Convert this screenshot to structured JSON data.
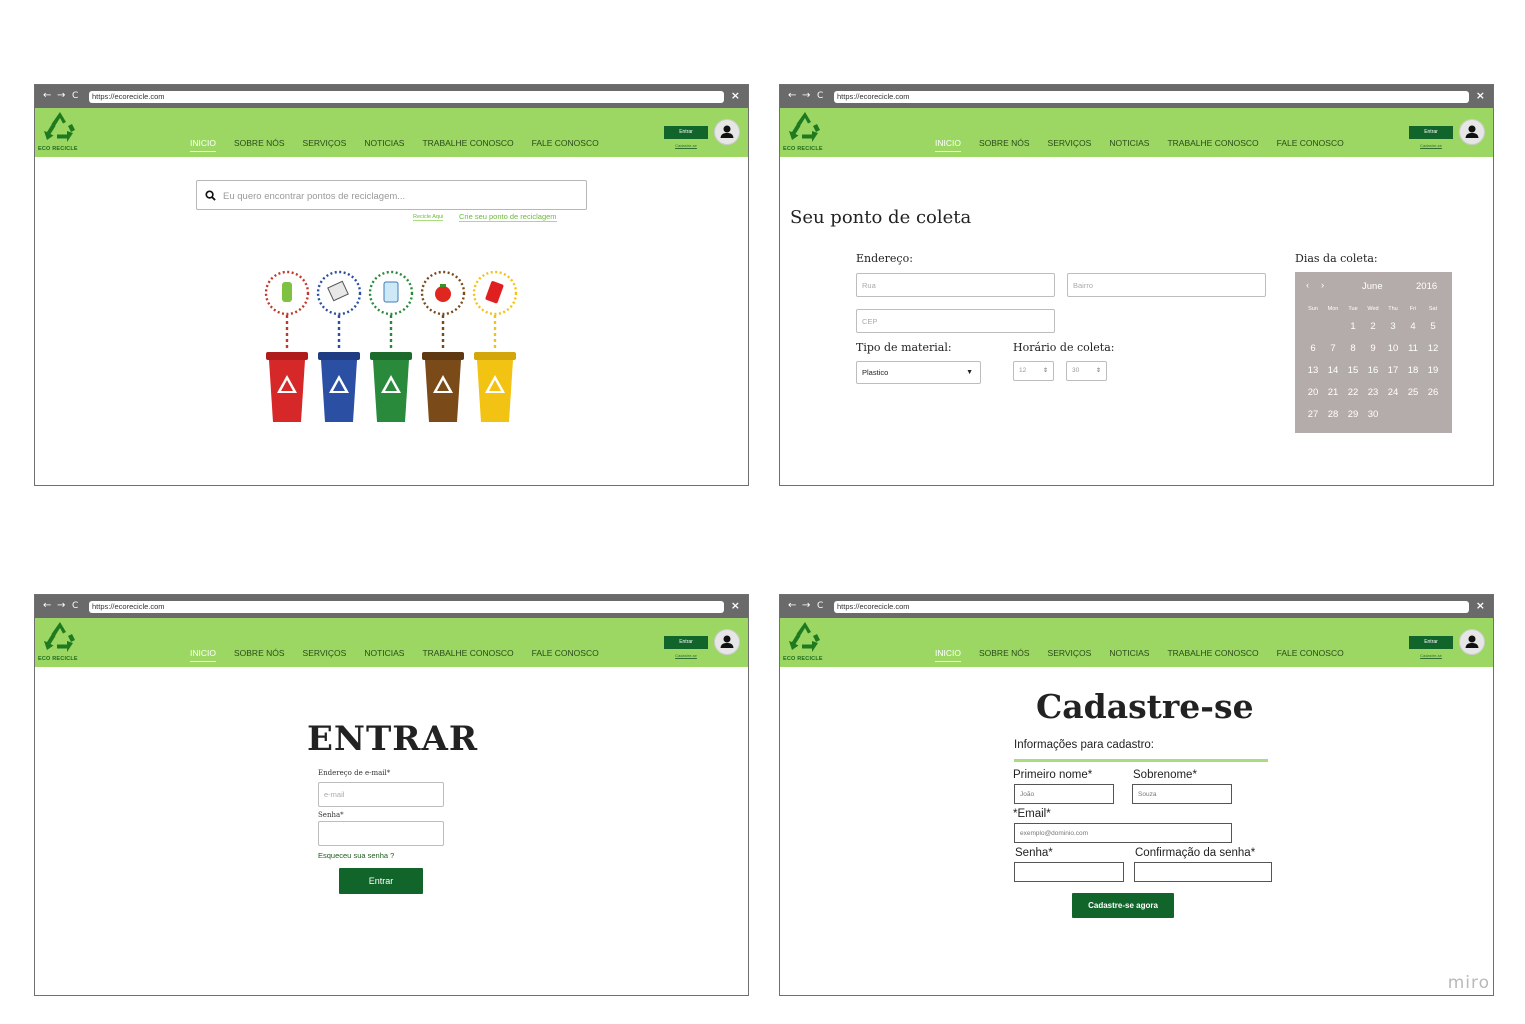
{
  "browser": {
    "url": "https://ecorecicle.com",
    "back_icon": "←",
    "forward_icon": "→",
    "reload_icon": "C",
    "close_icon": "×"
  },
  "header": {
    "logo_text": "ECO RECICLE",
    "menu": [
      "INICIO",
      "SOBRE NÓS",
      "SERVIÇOS",
      "NOTICIAS",
      "TRABALHE CONOSCO",
      "FALE CONOSCO"
    ],
    "active_menu": "INICIO",
    "login_button": "Entrar",
    "register_link": "Cadastre-se",
    "colors": {
      "header_bg": "#9bd762",
      "button_green": "#12652a",
      "chrome": "#6a6a6a"
    }
  },
  "home": {
    "search_placeholder": "Eu quero encontrar pontos de reciclagem...",
    "recycle_here": "Recicle Aqui",
    "create_point": "Crie seu ponto de reciclagem",
    "bins": [
      {
        "color": "#d62828",
        "icon": "bottle-icon",
        "ring": "#c0392b"
      },
      {
        "color": "#2b4fa3",
        "icon": "paper-icon",
        "ring": "#2b4fa3"
      },
      {
        "color": "#2a8a3c",
        "icon": "glass-icon",
        "ring": "#2a8a3c"
      },
      {
        "color": "#7a4a19",
        "icon": "tomato-icon",
        "ring": "#7a4a19"
      },
      {
        "color": "#f2c313",
        "icon": "can-icon",
        "ring": "#f2c313"
      }
    ]
  },
  "collect": {
    "title": "Seu ponto de coleta",
    "address_label": "Endereço:",
    "street_placeholder": "Rua",
    "district_placeholder": "Bairro",
    "zip_placeholder": "CEP",
    "material_label": "Tipo de material:",
    "material_value": "Plastico",
    "time_label": "Horário de coleta:",
    "hour_value": "12",
    "minute_value": "30",
    "days_label": "Dias da coleta:",
    "calendar": {
      "month": "June",
      "year": "2016",
      "weekdays": [
        "Sun",
        "Mon",
        "Tue",
        "Wed",
        "Thu",
        "Fri",
        "Sat"
      ],
      "days": [
        "",
        "",
        "1",
        "2",
        "3",
        "4",
        "5",
        "6",
        "7",
        "8",
        "9",
        "10",
        "11",
        "12",
        "13",
        "14",
        "15",
        "16",
        "17",
        "18",
        "19",
        "20",
        "21",
        "22",
        "23",
        "24",
        "25",
        "26",
        "27",
        "28",
        "29",
        "30"
      ],
      "bg_color": "#b4acab"
    }
  },
  "login": {
    "title": "ENTRAR",
    "email_label": "Endereço de e-mail*",
    "email_placeholder": "e-mail",
    "password_label": "Senha*",
    "forgot": "Esqueceu sua senha ?",
    "submit": "Entrar"
  },
  "signup": {
    "title": "Cadastre-se",
    "subtitle": "Informações para cadastro:",
    "first_name_label": "Primeiro nome*",
    "first_name_placeholder": "João",
    "last_name_label": "Sobrenome*",
    "last_name_placeholder": "Souza",
    "email_label": "*Email*",
    "email_placeholder": "exemplo@dominio.com",
    "password_label": "Senha*",
    "confirm_label": "Confirmação da senha*",
    "submit": "Cadastre-se agora"
  },
  "watermark": "miro"
}
